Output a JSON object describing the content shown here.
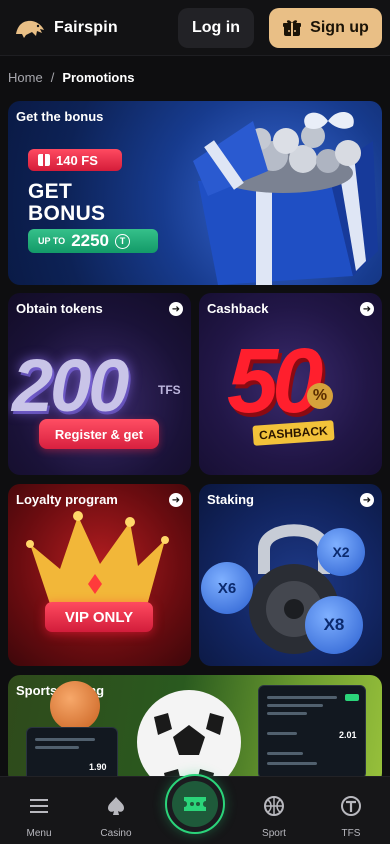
{
  "header": {
    "brand": "Fairspin",
    "login_label": "Log in",
    "signup_label": "Sign up",
    "signup_color": "#e9bf86"
  },
  "breadcrumb": {
    "home": "Home",
    "separator": "/",
    "current": "Promotions"
  },
  "promos": {
    "bonus": {
      "title": "Get the bonus",
      "badge": "140 FS",
      "headline_line1": "GET",
      "headline_line2": "BONUS",
      "upto_label": "UP TO",
      "upto_value": "2250",
      "currency_icon": "T"
    },
    "tokens": {
      "title": "Obtain tokens",
      "amount": "200",
      "amount_unit": "TFS",
      "cta": "Register & get"
    },
    "cashback": {
      "title": "Cashback",
      "amount": "50",
      "percent": "%",
      "label": "CASHBACK"
    },
    "loyalty": {
      "title": "Loyalty program",
      "cta": "VIP ONLY"
    },
    "staking": {
      "title": "Staking",
      "coin_labels": [
        "X6",
        "X2",
        "X8"
      ]
    },
    "sports": {
      "title": "Sports betting",
      "odds_right": "2.01",
      "odds_left": "1.90"
    }
  },
  "bottom_nav": {
    "items": [
      {
        "label": "Menu",
        "icon": "menu-icon"
      },
      {
        "label": "Casino",
        "icon": "spade-icon"
      },
      {
        "label": "",
        "icon": "ticket-icon"
      },
      {
        "label": "Sport",
        "icon": "basketball-icon"
      },
      {
        "label": "TFS",
        "icon": "tfs-coin-icon"
      }
    ],
    "accent": "#2bd47a"
  }
}
